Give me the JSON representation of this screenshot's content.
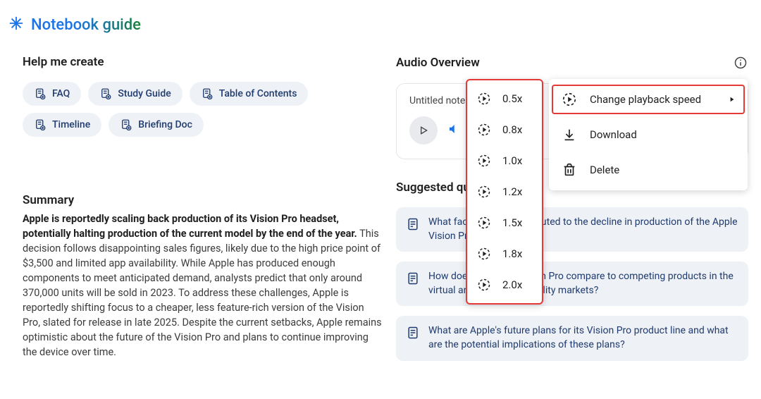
{
  "header": {
    "title": "Notebook guide"
  },
  "left": {
    "help_header": "Help me create",
    "pills": [
      {
        "label": "FAQ"
      },
      {
        "label": "Study Guide"
      },
      {
        "label": "Table of Contents"
      },
      {
        "label": "Timeline"
      },
      {
        "label": "Briefing Doc"
      }
    ],
    "summary_header": "Summary",
    "summary_lead": "Apple is reportedly scaling back production of its Vision Pro headset, potentially halting production of the current model by the end of the year.",
    "summary_rest": " This decision follows disappointing sales figures, likely due to the high price point of $3,500 and limited app availability. While Apple has produced enough components to meet anticipated demand, analysts predict that only around 370,000 units will be sold in 2023. To address these challenges, Apple is reportedly shifting focus to a cheaper, less feature-rich version of the Vision Pro, slated for release in late 2025. Despite the current setbacks, Apple remains optimistic about the future of the Vision Pro and plans to continue improving the device over time."
  },
  "right": {
    "audio_header": "Audio Overview",
    "card_title": "Untitled notebook",
    "suggested_header": "Suggested questions",
    "questions": [
      "What factors have contributed to the decline in production of the Apple Vision Pro?",
      "How does the Apple Vision Pro compare to competing products in the virtual and augmented reality markets?",
      "What are Apple's future plans for its Vision Pro product line and what are the potential implications of these plans?"
    ]
  },
  "speed_menu": {
    "options": [
      "0.5x",
      "0.8x",
      "1.0x",
      "1.2x",
      "1.5x",
      "1.8x",
      "2.0x"
    ]
  },
  "action_menu": {
    "change_speed": "Change playback speed",
    "download": "Download",
    "delete": "Delete"
  }
}
